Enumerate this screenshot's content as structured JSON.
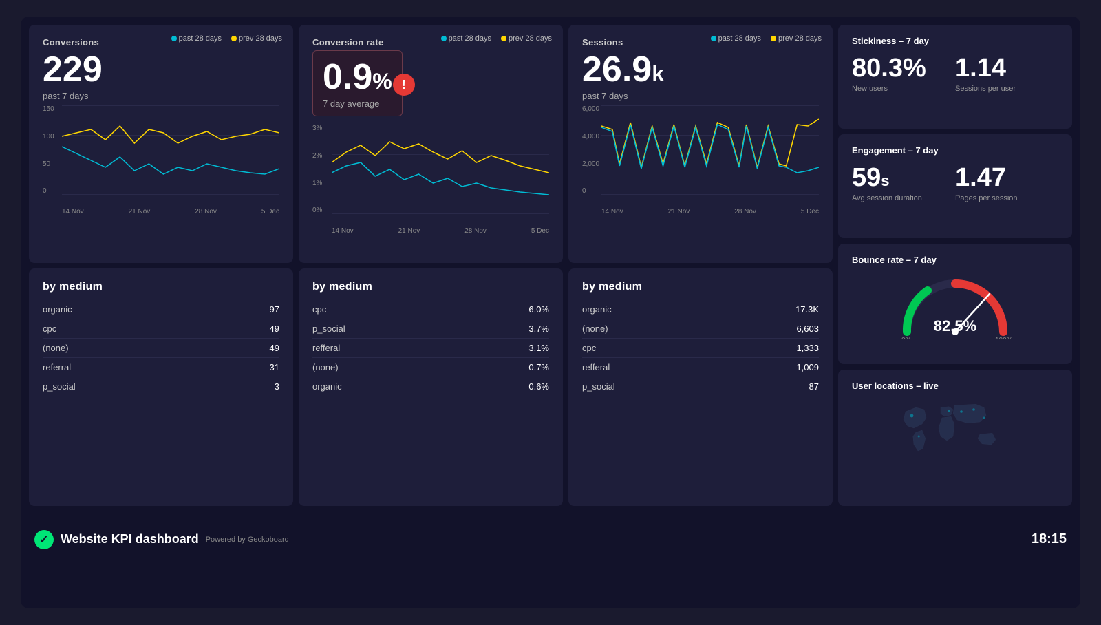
{
  "dashboard": {
    "title": "Website KPI dashboard",
    "powered_by": "Powered by Geckoboard",
    "time": "18:15"
  },
  "conversions": {
    "title": "Conversions",
    "value": "229",
    "subtitle": "past 7 days",
    "chart": {
      "y_labels": [
        "150",
        "100",
        "50",
        "0"
      ],
      "x_labels": [
        "14 Nov",
        "21 Nov",
        "28 Nov",
        "5 Dec"
      ],
      "legend_past": "past 28 days",
      "legend_prev": "prev 28 days"
    }
  },
  "conversion_rate": {
    "title": "Conversion rate",
    "value": "0.9",
    "unit": "%",
    "subtitle": "7 day average",
    "chart": {
      "y_labels": [
        "3%",
        "2%",
        "1%",
        "0%"
      ],
      "x_labels": [
        "14 Nov",
        "21 Nov",
        "28 Nov",
        "5 Dec"
      ],
      "legend_past": "past 28 days",
      "legend_prev": "prev 28 days"
    }
  },
  "sessions": {
    "title": "Sessions",
    "value": "26.9",
    "unit": "k",
    "subtitle": "past 7 days",
    "chart": {
      "y_labels": [
        "6,000",
        "4,000",
        "2,000",
        "0"
      ],
      "x_labels": [
        "14 Nov",
        "21 Nov",
        "28 Nov",
        "5 Dec"
      ],
      "legend_past": "past 28 days",
      "legend_prev": "prev 28 days"
    }
  },
  "stickiness": {
    "title": "Stickiness – 7 day",
    "new_users_value": "80.3%",
    "new_users_label": "New users",
    "sessions_per_user_value": "1.14",
    "sessions_per_user_label": "Sessions per user"
  },
  "engagement": {
    "title": "Engagement – 7 day",
    "avg_session_value": "59",
    "avg_session_unit": "s",
    "avg_session_label": "Avg session duration",
    "pages_per_session_value": "1.47",
    "pages_per_session_label": "Pages per session"
  },
  "bounce_rate": {
    "title": "Bounce rate – 7 day",
    "value": "82.5",
    "unit": "%"
  },
  "user_locations": {
    "title": "User locations – live"
  },
  "by_medium_conversions": {
    "title": "by medium",
    "rows": [
      {
        "label": "organic",
        "value": "97"
      },
      {
        "label": "cpc",
        "value": "49"
      },
      {
        "label": "(none)",
        "value": "49"
      },
      {
        "label": "referral",
        "value": "31"
      },
      {
        "label": "p_social",
        "value": "3"
      }
    ]
  },
  "by_medium_conversion_rate": {
    "title": "by medium",
    "rows": [
      {
        "label": "cpc",
        "value": "6.0%"
      },
      {
        "label": "p_social",
        "value": "3.7%"
      },
      {
        "label": "refferal",
        "value": "3.1%"
      },
      {
        "label": "(none)",
        "value": "0.7%"
      },
      {
        "label": "organic",
        "value": "0.6%"
      }
    ]
  },
  "by_medium_sessions": {
    "title": "by medium",
    "rows": [
      {
        "label": "organic",
        "value": "17.3K"
      },
      {
        "label": "(none)",
        "value": "6,603"
      },
      {
        "label": "cpc",
        "value": "1,333"
      },
      {
        "label": "refferal",
        "value": "1,009"
      },
      {
        "label": "p_social",
        "value": "87"
      }
    ]
  },
  "colors": {
    "cyan": "#00bcd4",
    "yellow": "#ffd600",
    "background": "#1e1e3a",
    "card_bg": "#1e1e3a",
    "dark_bg": "#12122a"
  }
}
